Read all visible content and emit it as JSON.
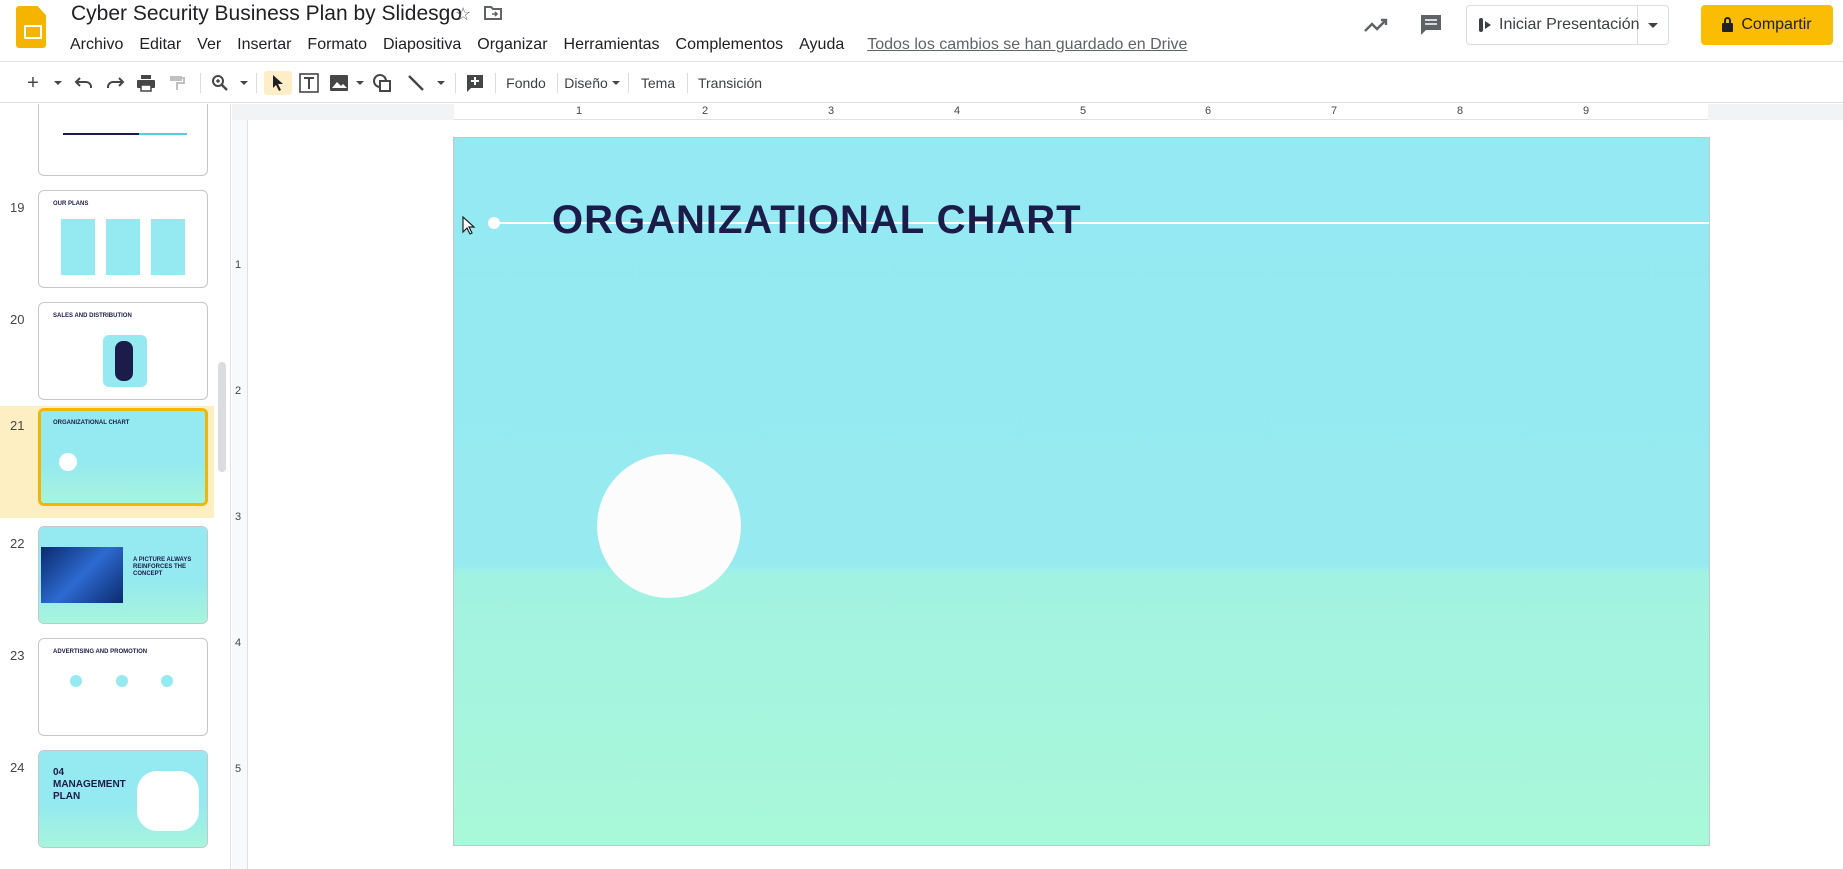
{
  "app": {
    "title": "Cyber Security Business Plan by Slidesgo",
    "saved_status": "Todos los cambios se han guardado en Drive"
  },
  "menu": [
    "Archivo",
    "Editar",
    "Ver",
    "Insertar",
    "Formato",
    "Diapositiva",
    "Organizar",
    "Herramientas",
    "Complementos",
    "Ayuda"
  ],
  "header_actions": {
    "present_label": "Iniciar Presentación",
    "share_label": "Compartir"
  },
  "toolbar": {
    "background_label": "Fondo",
    "layout_label": "Diseño",
    "theme_label": "Tema",
    "transition_label": "Transición"
  },
  "filmstrip": {
    "slides": [
      {
        "number": "",
        "title": ""
      },
      {
        "number": "19",
        "title": "OUR PLANS"
      },
      {
        "number": "20",
        "title": "SALES AND DISTRIBUTION"
      },
      {
        "number": "21",
        "title": "ORGANIZATIONAL CHART",
        "active": true
      },
      {
        "number": "22",
        "title": "A PICTURE ALWAYS REINFORCES THE CONCEPT"
      },
      {
        "number": "23",
        "title": "ADVERTISING AND PROMOTION"
      },
      {
        "number": "24",
        "title": "04 MANAGEMENT PLAN"
      }
    ]
  },
  "ruler": {
    "top_numbers": [
      "1",
      "2",
      "3",
      "4",
      "5",
      "6",
      "7",
      "8",
      "9"
    ],
    "left_numbers": [
      "1",
      "2",
      "3",
      "4",
      "5"
    ]
  },
  "slide": {
    "title": "ORGANIZATIONAL CHART"
  },
  "colors": {
    "accent_yellow": "#fbbc04",
    "slide_cyan": "#94e9f2",
    "slide_mint": "#a9f8d9",
    "title_navy": "#1c1c4a"
  }
}
